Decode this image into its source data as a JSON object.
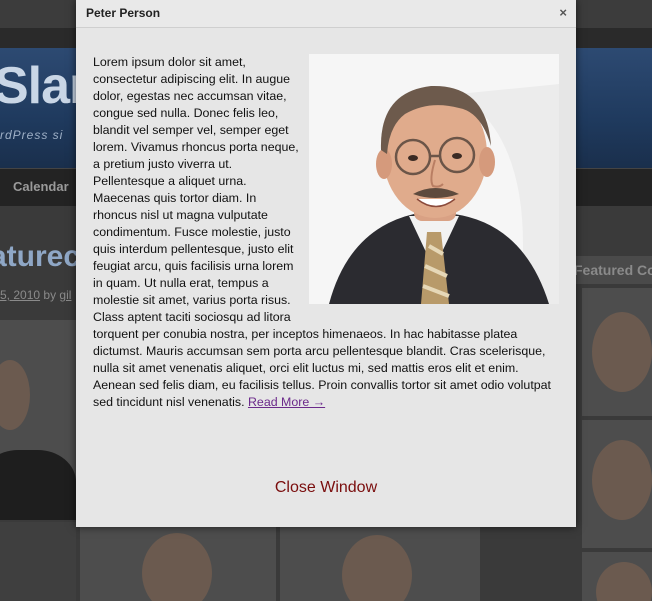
{
  "background": {
    "site_logo": "Slam",
    "site_tagline": "rdPress si",
    "nav_item": "Calendar",
    "featured_heading": "aturec",
    "post_meta_date": "5, 2010",
    "post_meta_by": "by",
    "post_meta_author": "gil",
    "sidebar_title": "Featured Co"
  },
  "modal": {
    "title": "Peter Person",
    "close_symbol": "×",
    "body_text": "Lorem ipsum dolor sit amet, consectetur adipiscing elit. In augue dolor, egestas nec accumsan vitae, congue sed nulla. Donec felis leo, blandit vel semper vel, semper eget lorem. Vivamus rhoncus porta neque, a pretium justo viverra ut. Pellentesque a aliquet urna. Maecenas quis tortor diam. In rhoncus nisl ut magna vulputate condimentum. Fusce molestie, justo quis interdum pellentesque, justo elit feugiat arcu, quis facilisis urna lorem in quam. Ut nulla erat, tempus a molestie sit amet, varius porta risus. Class aptent taciti sociosqu ad litora torquent per conubia nostra, per inceptos himenaeos. In hac habitasse platea dictumst. Mauris accumsan sem porta arcu pellentesque blandit. Cras scelerisque, nulla sit amet venenatis aliquet, orci elit luctus mi, sed mattis eros elit et enim. Aenean sed felis diam, eu facilisis tellus. Proin convallis tortor sit amet odio volutpat sed tincidunt nisl venenatis.",
    "read_more": "Read More →",
    "close_window": "Close Window"
  },
  "colors": {
    "modal_bg": "#e6e6e6",
    "link": "#6b2a8a",
    "close_window": "#7a0d0d"
  }
}
